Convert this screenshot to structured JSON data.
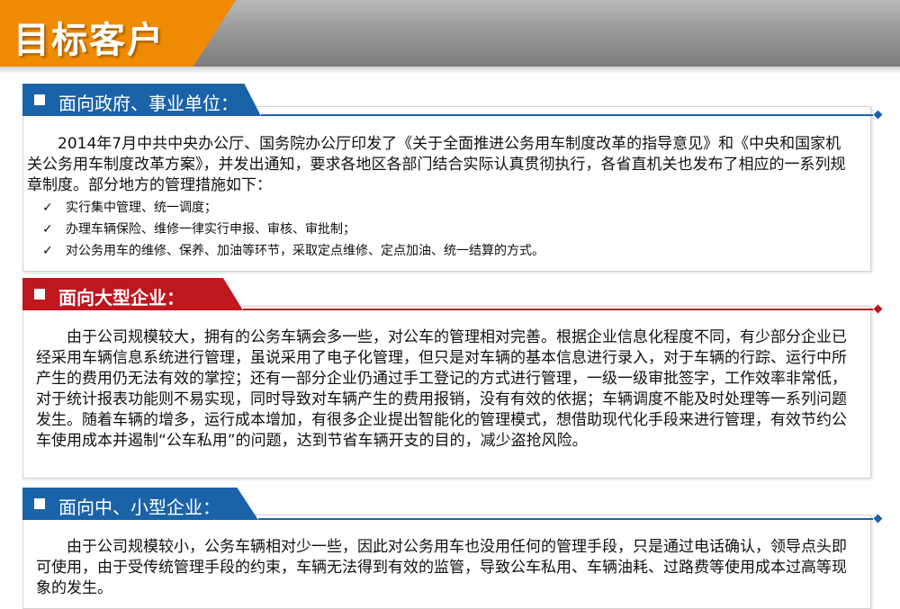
{
  "page": {
    "title": "目标客户"
  },
  "sections": [
    {
      "heading": "面向政府、事业单位：",
      "color": "#1a63a8",
      "paragraph": "2014年7月中共中央办公厅、国务院办公厅印发了《关于全面推进公务用车制度改革的指导意见》和《中央和国家机关公务用车制度改革方案》，并发出通知，要求各地区各部门结合实际认真贯彻执行，各省直机关也发布了相应的一系列规章制度。部分地方的管理措施如下：",
      "check_icon": "checkmark-icon",
      "items": [
        "实行集中管理、统一调度；",
        "办理车辆保险、维修一律实行申报、审核、审批制；",
        "对公务用车的维修、保养、加油等环节，采取定点维修、定点加油、统一结算的方式。"
      ]
    },
    {
      "heading": "面向大型企业：",
      "color": "#c0161d",
      "paragraph": "由于公司规模较大，拥有的公务车辆会多一些，对公车的管理相对完善。根据企业信息化程度不同，有少部分企业已经采用车辆信息系统进行管理，虽说采用了电子化管理，但只是对车辆的基本信息进行录入，对于车辆的行踪、运行中所产生的费用仍无法有效的掌控；还有一部分企业仍通过手工登记的方式进行管理，一级一级审批签字，工作效率非常低，对于统计报表功能则不易实现，同时导致对车辆产生的费用报销，没有有效的依据；车辆调度不能及时处理等一系列问题发生。随着车辆的增多，运行成本增加，有很多企业提出智能化的管理模式，想借助现代化手段来进行管理，有效节约公车使用成本并遏制“公车私用”的问题，达到节省车辆开支的目的，减少盗抢风险。"
    },
    {
      "heading": "面向中、小型企业：",
      "color": "#1a63a8",
      "paragraph": "由于公司规模较小，公务车辆相对少一些，因此对公务用车也没用任何的管理手段，只是通过电话确认，领导点头即可使用，由于受传统管理手段的约束，车辆无法得到有效的监管，导致公车私用、车辆油耗、过路费等使用成本过高等现象的发生。"
    }
  ]
}
